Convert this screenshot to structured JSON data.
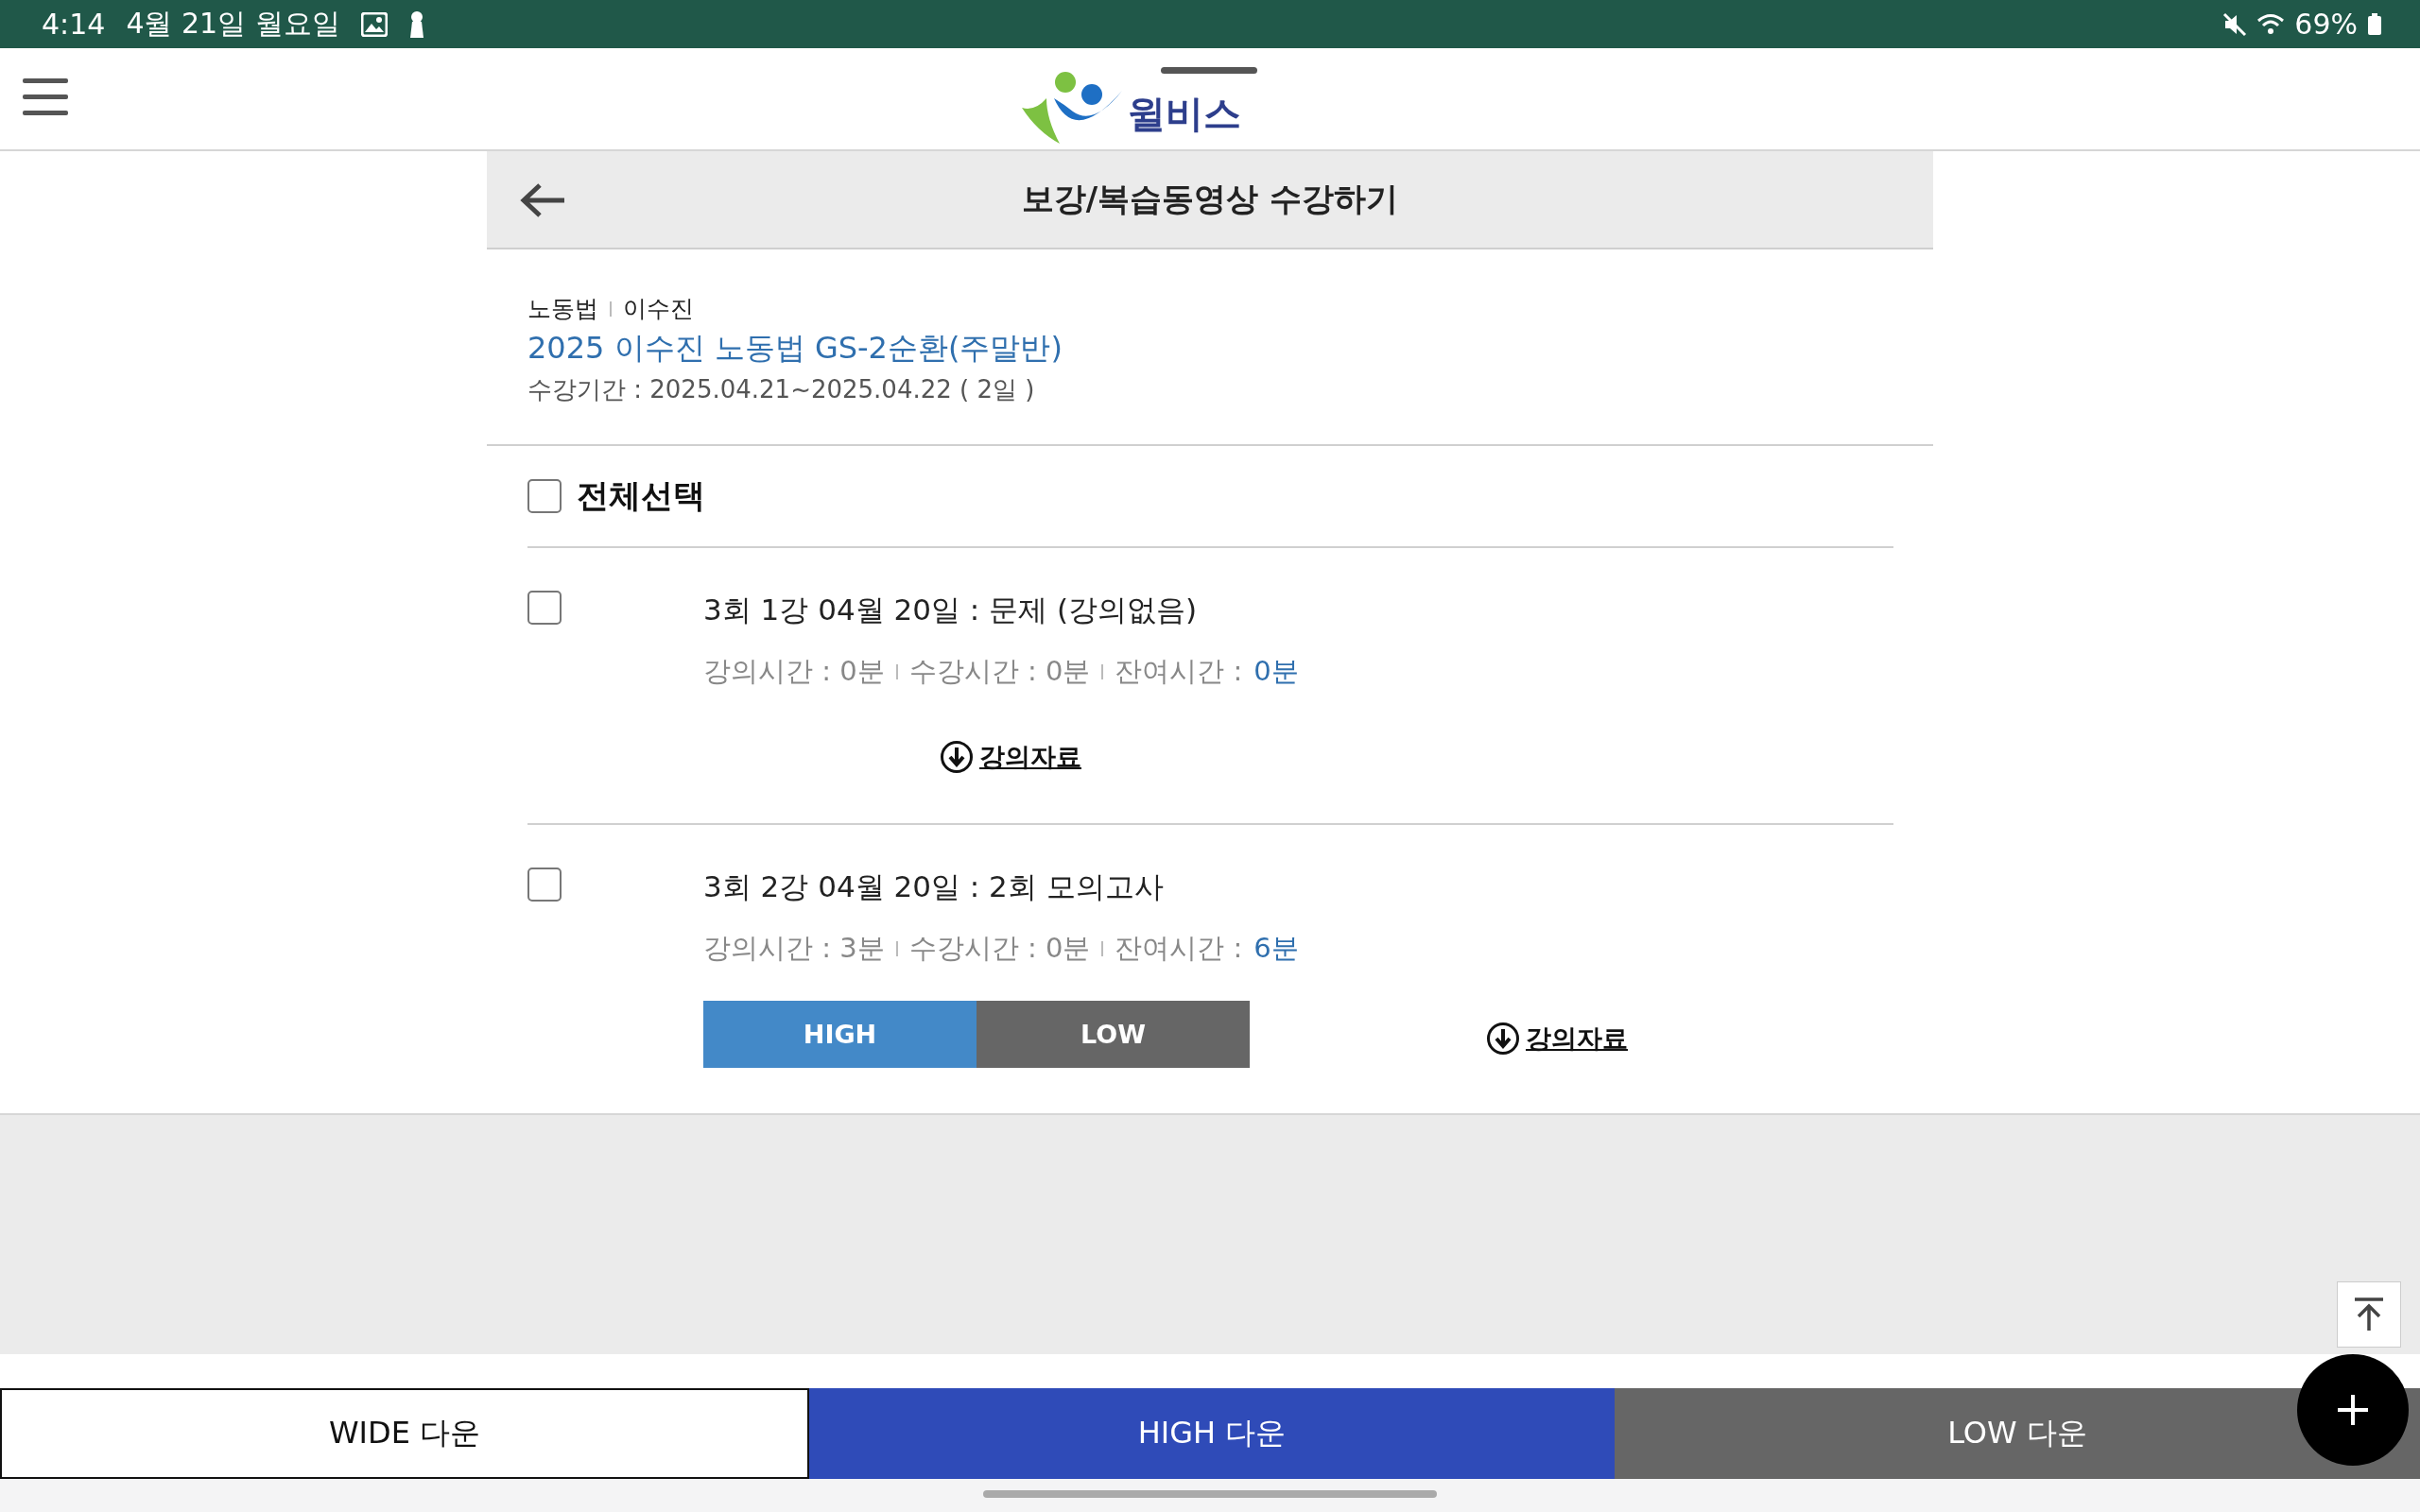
{
  "status_bar": {
    "time": "4:14",
    "date": "4월 21일 월요일",
    "battery": "69%"
  },
  "header": {
    "logo_text": "윌비스"
  },
  "title_bar": {
    "title": "보강/복습동영상 수강하기"
  },
  "course": {
    "subject": "노동법",
    "teacher": "이수진",
    "title": "2025 이수진 노동법 GS-2순환(주말반)",
    "period": "수강기간 : 2025.04.21~2025.04.22 ( 2일 )"
  },
  "select_all": {
    "label": "전체선택",
    "checked": false
  },
  "lectures": [
    {
      "title": "3회 1강 04월 20일 : 문제 (강의없음)",
      "checked": false,
      "lecture_time": "강의시간 : 0분",
      "watched_time": "수강시간 : 0분",
      "remaining_label": "잔여시간 :",
      "remaining_value": "0분",
      "material": "강의자료"
    },
    {
      "title": "3회 2강 04월 20일 : 2회 모의고사",
      "checked": false,
      "lecture_time": "강의시간 : 3분",
      "watched_time": "수강시간 : 0분",
      "remaining_label": "잔여시간 :",
      "remaining_value": "6분",
      "quality_buttons": [
        {
          "label": "HIGH",
          "kind": "high"
        },
        {
          "label": "LOW",
          "kind": "low"
        }
      ],
      "material": "강의자료"
    }
  ],
  "bottom_buttons": [
    {
      "label": "WIDE 다운",
      "kind": "wide"
    },
    {
      "label": "HIGH 다운",
      "kind": "high"
    },
    {
      "label": "LOW 다운",
      "kind": "low"
    }
  ]
}
